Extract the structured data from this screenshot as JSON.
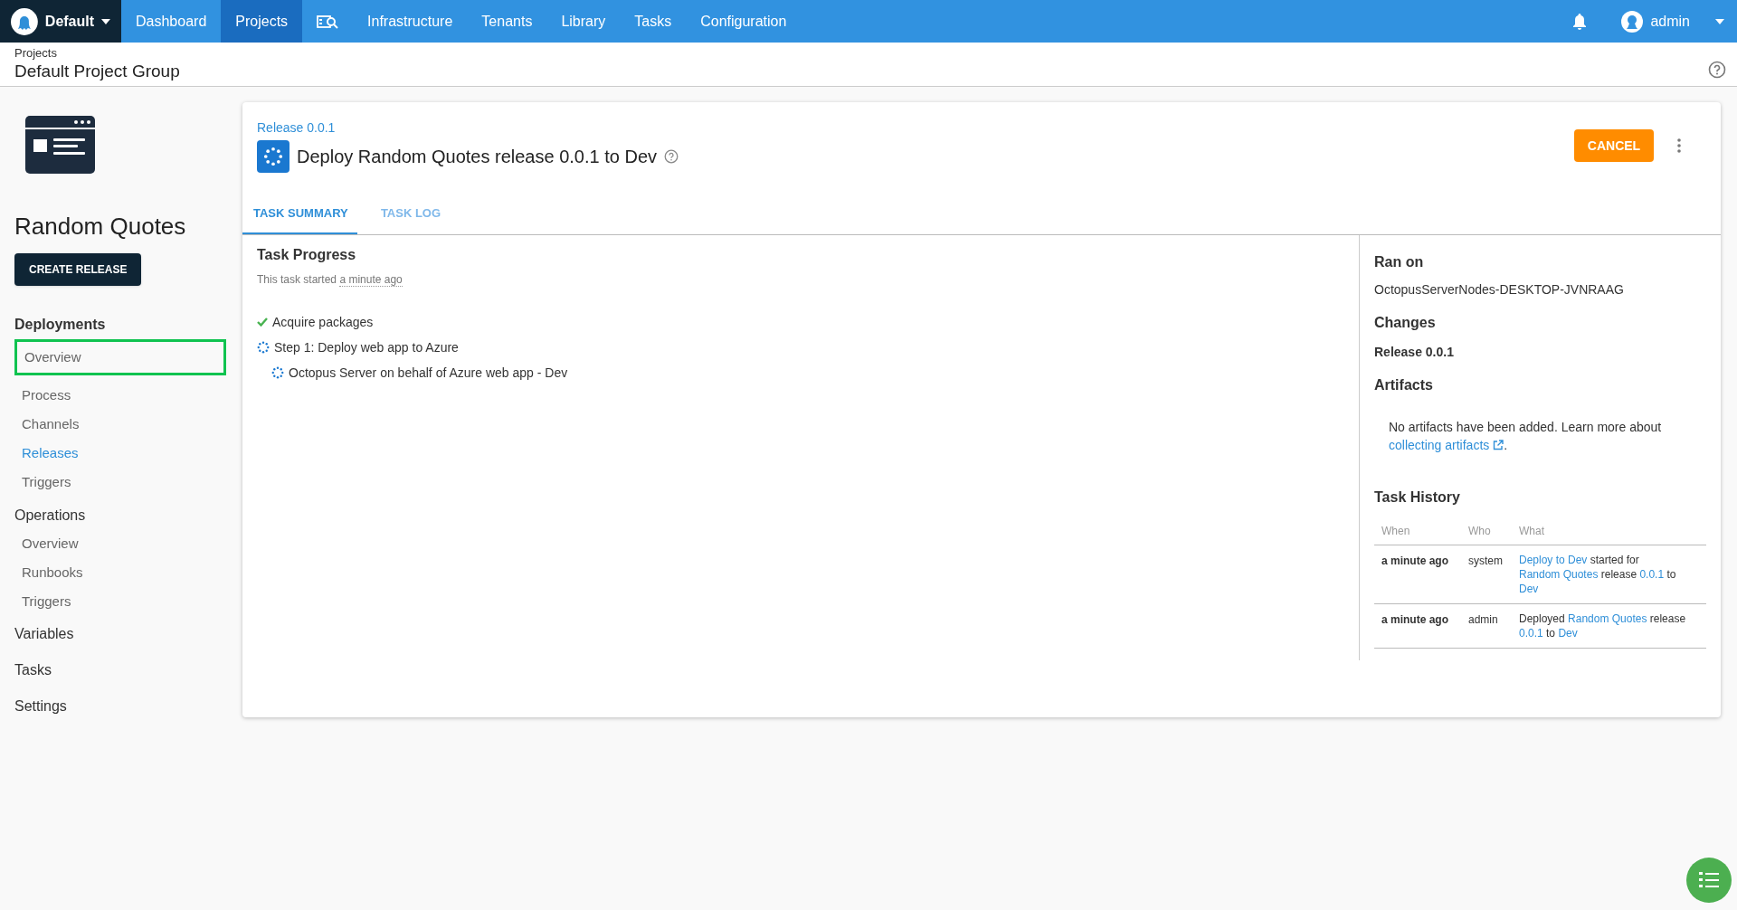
{
  "topbar": {
    "space": "Default",
    "nav": [
      {
        "kind": "text",
        "label": "Dashboard",
        "selected": false
      },
      {
        "kind": "text",
        "label": "Projects",
        "selected": true
      },
      {
        "kind": "icon",
        "selected": false
      },
      {
        "kind": "text",
        "label": "Infrastructure",
        "selected": false
      },
      {
        "kind": "text",
        "label": "Tenants",
        "selected": false
      },
      {
        "kind": "text",
        "label": "Library",
        "selected": false
      },
      {
        "kind": "text",
        "label": "Tasks",
        "selected": false
      },
      {
        "kind": "text",
        "label": "Configuration",
        "selected": false
      }
    ],
    "user": "admin"
  },
  "breadcrumb": {
    "parent": "Projects",
    "title": "Default Project Group"
  },
  "sidebar": {
    "project": "Random Quotes",
    "create_button": "CREATE RELEASE",
    "sections": [
      {
        "label": "Deployments",
        "items": [
          {
            "label": "Overview",
            "selected": false,
            "highlighted": true
          },
          {
            "label": "Process",
            "selected": false,
            "highlighted": false
          },
          {
            "label": "Channels",
            "selected": false,
            "highlighted": false
          },
          {
            "label": "Releases",
            "selected": true,
            "highlighted": false
          },
          {
            "label": "Triggers",
            "selected": false,
            "highlighted": false
          }
        ]
      },
      {
        "label": "Operations",
        "items": [
          {
            "label": "Overview",
            "selected": false,
            "highlighted": false
          },
          {
            "label": "Runbooks",
            "selected": false,
            "highlighted": false
          },
          {
            "label": "Triggers",
            "selected": false,
            "highlighted": false
          }
        ]
      },
      {
        "label": "Variables"
      },
      {
        "label": "Tasks"
      },
      {
        "label": "Settings"
      }
    ]
  },
  "task": {
    "release_link": "Release 0.0.1",
    "title": "Deploy Random Quotes release 0.0.1 to Dev",
    "cancel_button": "CANCEL",
    "tabs": [
      {
        "label": "TASK SUMMARY",
        "selected": true
      },
      {
        "label": "TASK LOG",
        "selected": false
      }
    ],
    "progress": {
      "heading": "Task Progress",
      "started_prefix": "This task started",
      "started_time": "a minute ago",
      "steps": [
        {
          "label": "Acquire packages",
          "kind": "success"
        },
        {
          "label": "Step 1: Deploy web app to Azure",
          "kind": "running",
          "children": [
            {
              "label": "Octopus Server on behalf of Azure web app - Dev",
              "kind": "running"
            }
          ]
        }
      ]
    },
    "details": {
      "ran_on_heading": "Ran on",
      "ran_on": "OctopusServerNodes-DESKTOP-JVNRAAG",
      "changes_heading": "Changes",
      "changes": "Release 0.0.1",
      "artifacts_heading": "Artifacts",
      "artifacts_text": "No artifacts have been added. Learn more about",
      "artifacts_link": "collecting artifacts",
      "artifacts_end": ".",
      "history_heading": "Task History",
      "history_columns": [
        "When",
        "Who",
        "What"
      ],
      "history": [
        {
          "when": "a minute ago",
          "who": "system",
          "what": [
            {
              "text": "Deploy to Dev",
              "link": true
            },
            {
              "text": " started for ",
              "link": false
            },
            {
              "text": "Random Quotes",
              "link": true
            },
            {
              "text": " release ",
              "link": false
            },
            {
              "text": "0.0.1",
              "link": true
            },
            {
              "text": " to ",
              "link": false
            },
            {
              "text": "Dev",
              "link": true
            }
          ]
        },
        {
          "when": "a minute ago",
          "who": "admin",
          "what": [
            {
              "text": "Deployed ",
              "link": false
            },
            {
              "text": "Random Quotes",
              "link": true
            },
            {
              "text": " release ",
              "link": false
            },
            {
              "text": "0.0.1",
              "link": true
            },
            {
              "text": " to ",
              "link": false
            },
            {
              "text": "Dev",
              "link": true
            }
          ]
        }
      ]
    }
  }
}
